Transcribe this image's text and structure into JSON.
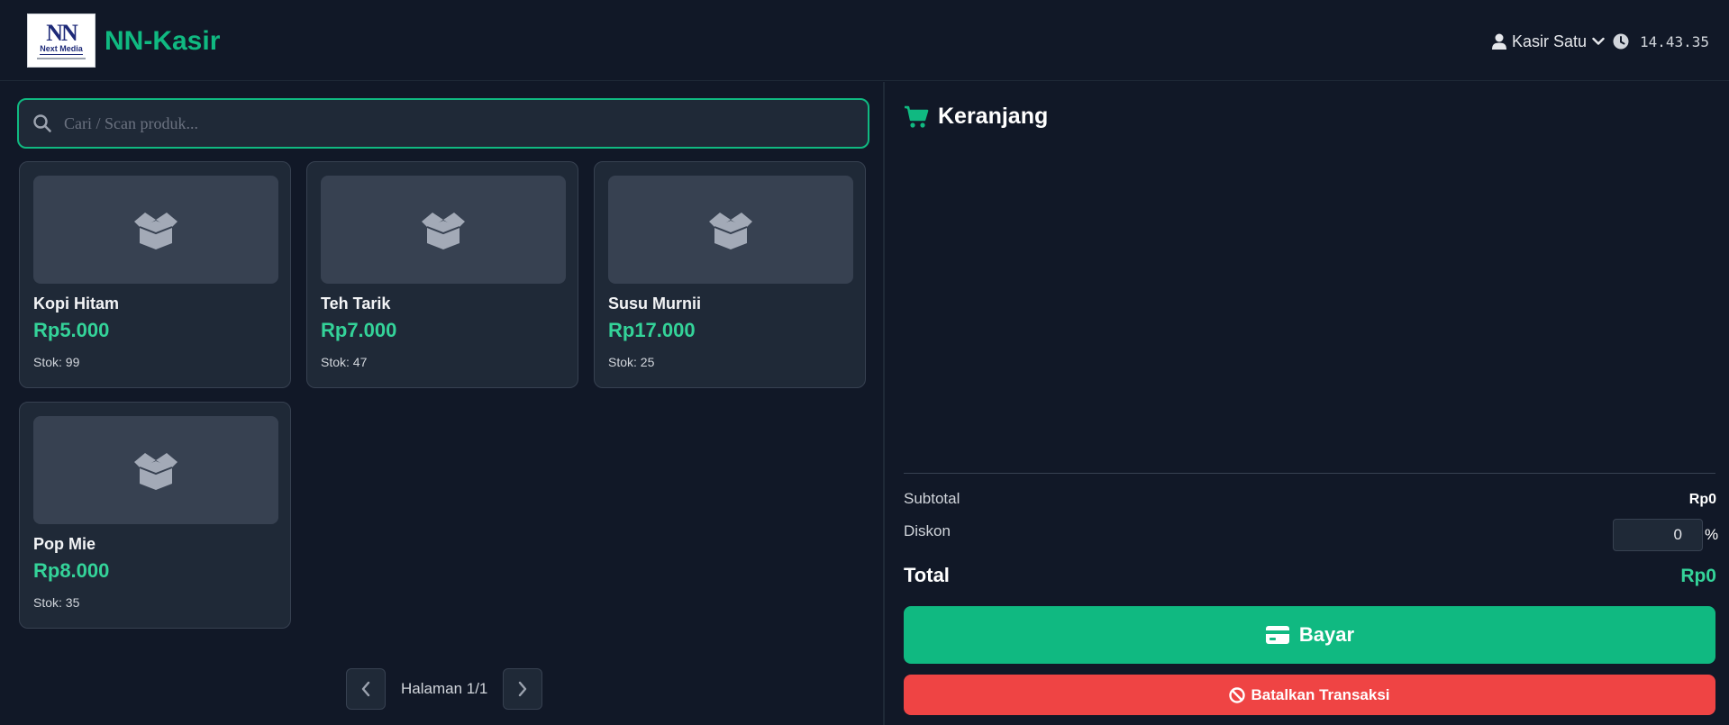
{
  "header": {
    "logo_mark": "NN",
    "logo_text": "Next Media",
    "app_title": "NN-Kasir",
    "user_name": "Kasir Satu",
    "clock_time": "14.43.35"
  },
  "search": {
    "placeholder": "Cari / Scan produk...",
    "value": ""
  },
  "products": [
    {
      "name": "Kopi Hitam",
      "price": "Rp5.000",
      "stock": "Stok: 99"
    },
    {
      "name": "Teh Tarik",
      "price": "Rp7.000",
      "stock": "Stok: 47"
    },
    {
      "name": "Susu Murnii",
      "price": "Rp17.000",
      "stock": "Stok: 25"
    },
    {
      "name": "Pop Mie",
      "price": "Rp8.000",
      "stock": "Stok: 35"
    }
  ],
  "pagination": {
    "label": "Halaman 1/1"
  },
  "cart": {
    "title": "Keranjang",
    "subtotal_label": "Subtotal",
    "subtotal_value": "Rp0",
    "discount_label": "Diskon",
    "discount_value": "0",
    "discount_unit": "%",
    "total_label": "Total",
    "total_value": "Rp0",
    "pay_label": "Bayar",
    "cancel_label": "Batalkan Transaksi"
  },
  "colors": {
    "background": "#111827",
    "accent": "#10b981",
    "price": "#34d399",
    "danger": "#ef4444",
    "card": "#1f2937"
  },
  "icons": {
    "user": "user-icon",
    "dropdown": "chevron-down-icon",
    "clock": "clock-icon",
    "search": "search-icon",
    "product": "box-open-icon",
    "cart": "shopping-cart-icon",
    "pay": "credit-card-icon",
    "cancel": "ban-icon",
    "prev": "chevron-left-icon",
    "next": "chevron-right-icon"
  }
}
